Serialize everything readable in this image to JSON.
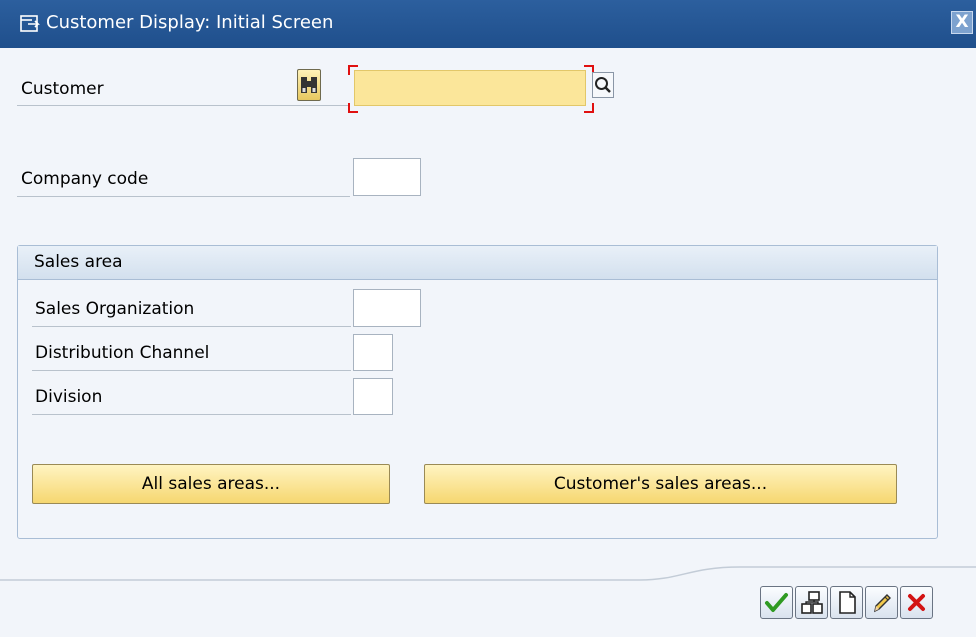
{
  "window": {
    "title": "Customer Display: Initial Screen",
    "close_label": "X",
    "colors": {
      "titlebar": "#1f4f8c",
      "background": "#f2f5fa",
      "required_field": "#fbe69a",
      "button": "#f6d770",
      "required_marker": "#e01010"
    }
  },
  "form": {
    "customer_label": "Customer",
    "customer_value": "",
    "company_code_label": "Company code",
    "company_code_value": ""
  },
  "sales_area": {
    "title": "Sales area",
    "sales_org_label": "Sales Organization",
    "sales_org_value": "",
    "distribution_channel_label": "Distribution Channel",
    "distribution_channel_value": "",
    "division_label": "Division",
    "division_value": "",
    "all_button": "All sales areas...",
    "customers_button": "Customer's sales areas..."
  },
  "toolbar": {
    "icons": [
      "check-icon",
      "hierarchy-icon",
      "new-document-icon",
      "pencil-icon",
      "cancel-icon"
    ]
  }
}
